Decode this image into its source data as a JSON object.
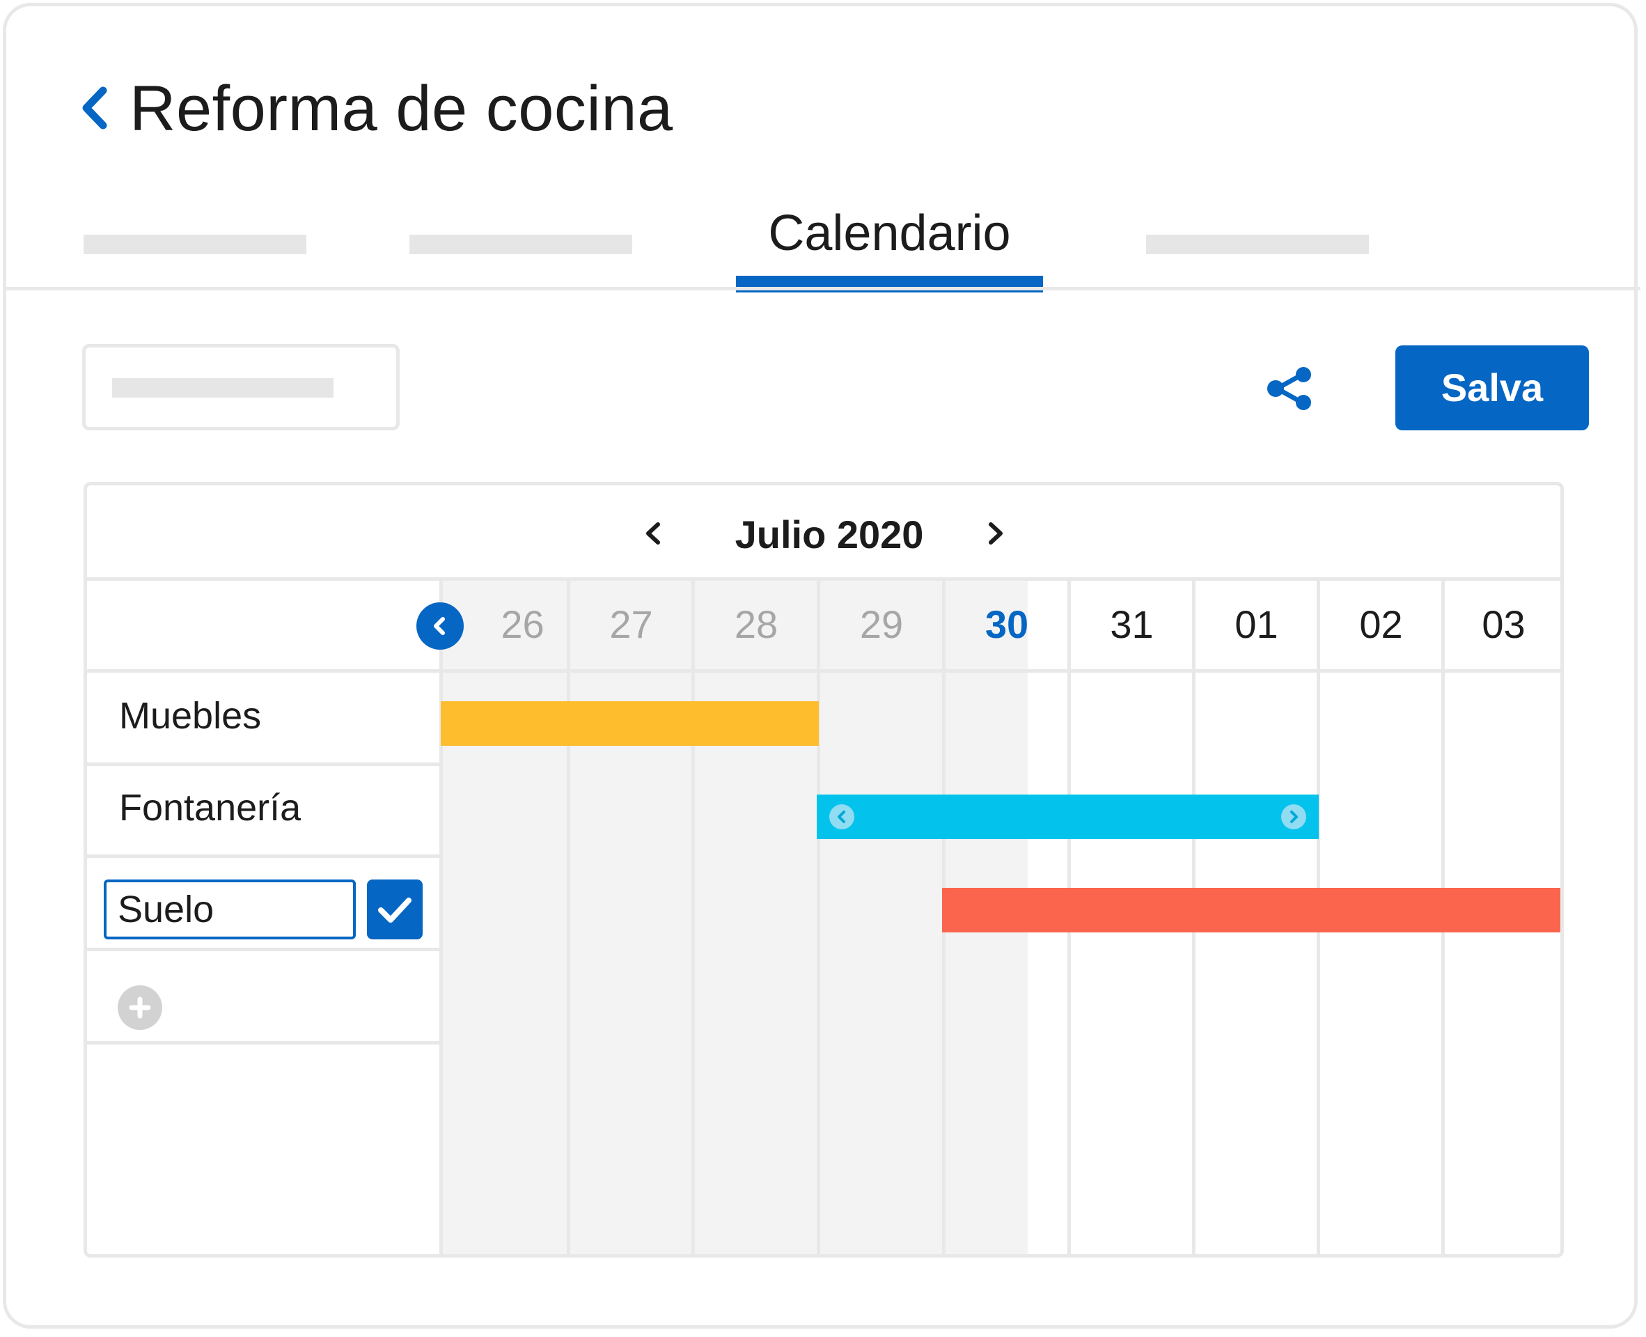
{
  "header": {
    "title": "Reforma de cocina"
  },
  "tabs": {
    "active_label": "Calendario"
  },
  "toolbar": {
    "save_label": "Salva"
  },
  "calendar": {
    "month_label": "Julio 2020",
    "days": [
      {
        "label": "26",
        "state": "past"
      },
      {
        "label": "27",
        "state": "past"
      },
      {
        "label": "28",
        "state": "past"
      },
      {
        "label": "29",
        "state": "past"
      },
      {
        "label": "30",
        "state": "today"
      },
      {
        "label": "31",
        "state": "future"
      },
      {
        "label": "01",
        "state": "future"
      },
      {
        "label": "02",
        "state": "future"
      },
      {
        "label": "03",
        "state": "future"
      }
    ],
    "tasks": [
      {
        "name": "Muebles",
        "color": "#fdbd2c",
        "start_day": "26",
        "end_day": "28"
      },
      {
        "name": "Fontanería",
        "color": "#03c3ec",
        "start_day": "29",
        "end_day": "01"
      },
      {
        "name": "Suelo",
        "color": "#fb654d",
        "start_day": "30",
        "end_day": "03",
        "editing": true
      }
    ]
  },
  "colors": {
    "accent": "#0566c4",
    "border": "#e8e8e8",
    "shade": "#f3f3f3"
  },
  "icons": [
    "chevron-left-icon",
    "share-icon",
    "chevron-right-icon",
    "check-icon",
    "plus-icon",
    "resize-handle-icon"
  ]
}
